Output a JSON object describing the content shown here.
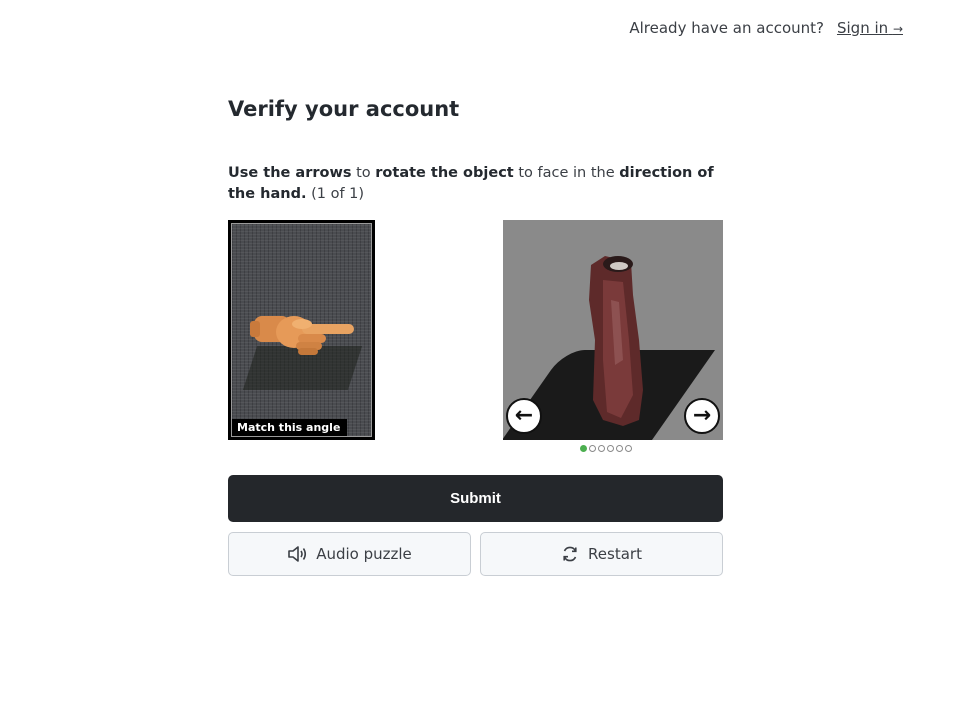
{
  "header": {
    "prompt": "Already have an account?",
    "signin_label": "Sign in",
    "signin_arrow": "→"
  },
  "title": "Verify your account",
  "instructions": {
    "p1": "Use the arrows",
    "p2": " to ",
    "p3": "rotate the object",
    "p4": " to face in the ",
    "p5": "direction of the hand.",
    "progress": " (1 of 1)"
  },
  "reference": {
    "label": "Match this angle",
    "icon": "pointing-hand-image"
  },
  "object_view": {
    "icon": "boot-object-image",
    "left_arrow": "←",
    "right_arrow": "→",
    "total_positions": 6,
    "current_position": 1
  },
  "buttons": {
    "submit": "Submit",
    "audio": "Audio puzzle",
    "restart": "Restart"
  },
  "colors": {
    "submit_bg": "#24272b",
    "active_dot": "#4caf50"
  }
}
